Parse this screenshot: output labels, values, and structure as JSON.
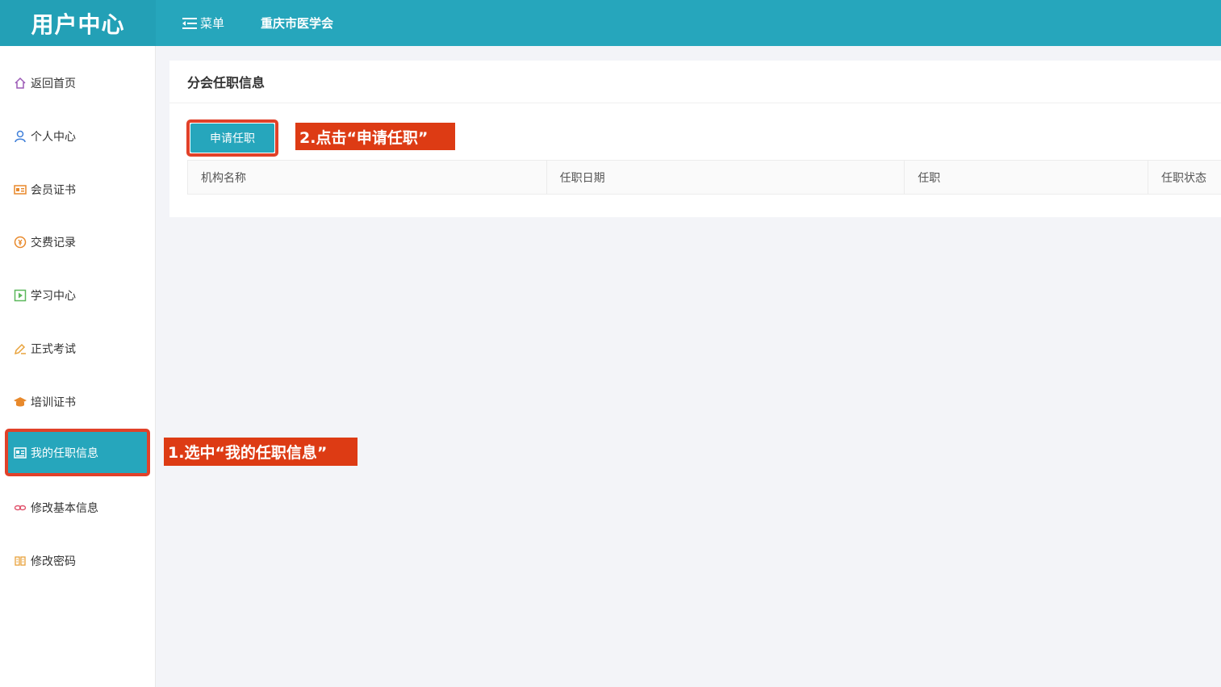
{
  "header": {
    "brand": "用户中心",
    "menu_label": "菜单",
    "org_name": "重庆市医学会"
  },
  "sidebar": {
    "items": [
      {
        "label": "返回首页",
        "icon": "home-icon"
      },
      {
        "label": "个人中心",
        "icon": "user-icon"
      },
      {
        "label": "会员证书",
        "icon": "certificate-icon"
      },
      {
        "label": "交费记录",
        "icon": "payment-icon"
      },
      {
        "label": "学习中心",
        "icon": "play-icon"
      },
      {
        "label": "正式考试",
        "icon": "pen-icon"
      },
      {
        "label": "培训证书",
        "icon": "graduation-cap-icon"
      },
      {
        "label": "我的任职信息",
        "icon": "id-card-icon",
        "active": true
      },
      {
        "label": "修改基本信息",
        "icon": "link-icon"
      },
      {
        "label": "修改密码",
        "icon": "key-icon"
      }
    ]
  },
  "main": {
    "title": "分会任职信息",
    "apply_button": "申请任职",
    "table": {
      "columns": [
        "机构名称",
        "任职日期",
        "任职",
        "任职状态"
      ]
    }
  },
  "annotations": {
    "step1": "1.选中“我的任职信息”",
    "step2": "2.点击“申请任职”"
  },
  "colors": {
    "primary": "#26a6bc",
    "highlight_border": "#e14129",
    "annotation_bg": "#dd3b14"
  }
}
